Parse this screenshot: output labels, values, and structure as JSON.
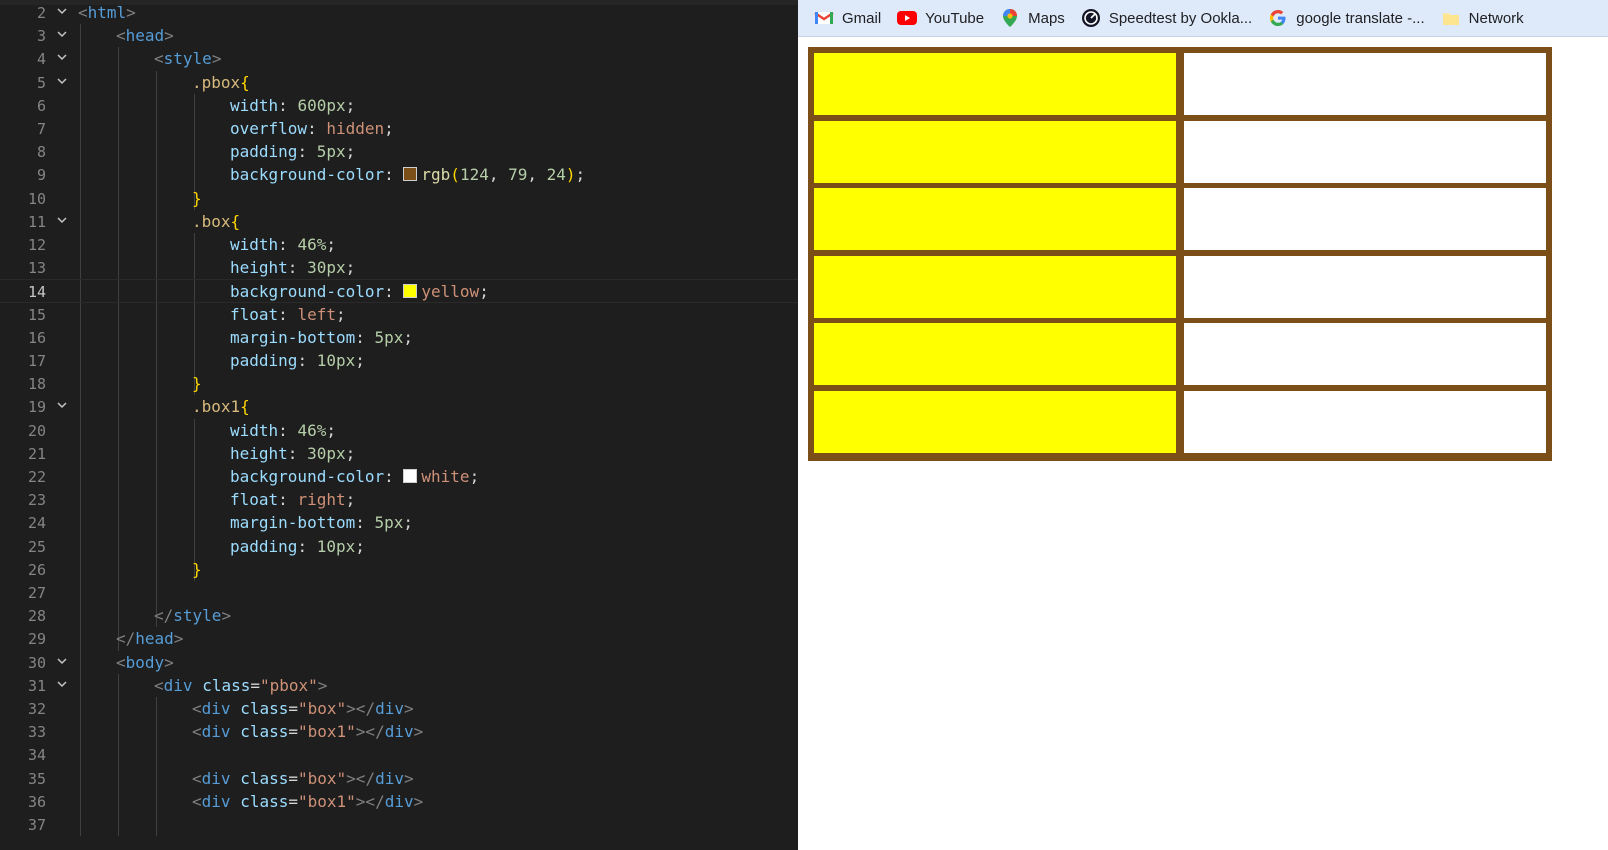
{
  "editor": {
    "lines": [
      {
        "n": "2",
        "fold": true,
        "tokens": [
          [
            "<",
            "t-punc"
          ],
          [
            "html",
            "t-tag"
          ],
          [
            ">",
            "t-punc"
          ]
        ]
      },
      {
        "n": "3",
        "fold": true,
        "tokens": [
          [
            "<",
            "t-punc"
          ],
          [
            "head",
            "t-tag"
          ],
          [
            ">",
            "t-punc"
          ]
        ]
      },
      {
        "n": "4",
        "fold": true,
        "tokens": [
          [
            "<",
            "t-punc"
          ],
          [
            "style",
            "t-tag"
          ],
          [
            ">",
            "t-punc"
          ]
        ]
      },
      {
        "n": "5",
        "fold": true,
        "tokens": [
          [
            ".pbox",
            "t-sel"
          ],
          [
            "{",
            "t-brace"
          ]
        ]
      },
      {
        "n": "6",
        "fold": false,
        "tokens": [
          [
            "width",
            "t-prop"
          ],
          [
            ": ",
            "t-txt"
          ],
          [
            "600px",
            "t-num"
          ],
          [
            ";",
            "t-txt"
          ]
        ]
      },
      {
        "n": "7",
        "fold": false,
        "tokens": [
          [
            "overflow",
            "t-prop"
          ],
          [
            ": ",
            "t-txt"
          ],
          [
            "hidden",
            "t-kw"
          ],
          [
            ";",
            "t-txt"
          ]
        ]
      },
      {
        "n": "8",
        "fold": false,
        "tokens": [
          [
            "padding",
            "t-prop"
          ],
          [
            ": ",
            "t-txt"
          ],
          [
            "5px",
            "t-num"
          ],
          [
            ";",
            "t-txt"
          ]
        ]
      },
      {
        "n": "9",
        "fold": false,
        "tokens": [
          [
            "background-color",
            "t-prop"
          ],
          [
            ": ",
            "t-txt"
          ],
          [
            "@swatch:#7c4f18",
            ""
          ],
          [
            "rgb",
            "t-fn"
          ],
          [
            "(",
            "t-brace"
          ],
          [
            "124",
            "t-num"
          ],
          [
            ", ",
            "t-txt"
          ],
          [
            "79",
            "t-num"
          ],
          [
            ", ",
            "t-txt"
          ],
          [
            "24",
            "t-num"
          ],
          [
            ")",
            "t-brace"
          ],
          [
            ";",
            "t-txt"
          ]
        ]
      },
      {
        "n": "10",
        "fold": false,
        "tokens": [
          [
            "}",
            "t-brace"
          ]
        ]
      },
      {
        "n": "11",
        "fold": true,
        "tokens": [
          [
            ".box",
            "t-sel"
          ],
          [
            "{",
            "t-brace"
          ]
        ]
      },
      {
        "n": "12",
        "fold": false,
        "tokens": [
          [
            "width",
            "t-prop"
          ],
          [
            ": ",
            "t-txt"
          ],
          [
            "46%",
            "t-num"
          ],
          [
            ";",
            "t-txt"
          ]
        ]
      },
      {
        "n": "13",
        "fold": false,
        "tokens": [
          [
            "height",
            "t-prop"
          ],
          [
            ": ",
            "t-txt"
          ],
          [
            "30px",
            "t-num"
          ],
          [
            ";",
            "t-txt"
          ]
        ]
      },
      {
        "n": "14",
        "fold": false,
        "active": true,
        "tokens": [
          [
            "background-color",
            "t-prop"
          ],
          [
            ": ",
            "t-txt"
          ],
          [
            "@swatch:#ffff00",
            ""
          ],
          [
            "yellow",
            "t-kw"
          ],
          [
            ";",
            "t-txt"
          ]
        ]
      },
      {
        "n": "15",
        "fold": false,
        "tokens": [
          [
            "float",
            "t-prop"
          ],
          [
            ": ",
            "t-txt"
          ],
          [
            "left",
            "t-kw"
          ],
          [
            ";",
            "t-txt"
          ]
        ]
      },
      {
        "n": "16",
        "fold": false,
        "tokens": [
          [
            "margin-bottom",
            "t-prop"
          ],
          [
            ": ",
            "t-txt"
          ],
          [
            "5px",
            "t-num"
          ],
          [
            ";",
            "t-txt"
          ]
        ]
      },
      {
        "n": "17",
        "fold": false,
        "tokens": [
          [
            "padding",
            "t-prop"
          ],
          [
            ": ",
            "t-txt"
          ],
          [
            "10px",
            "t-num"
          ],
          [
            ";",
            "t-txt"
          ]
        ]
      },
      {
        "n": "18",
        "fold": false,
        "tokens": [
          [
            "}",
            "t-brace"
          ]
        ]
      },
      {
        "n": "19",
        "fold": true,
        "tokens": [
          [
            ".box1",
            "t-sel"
          ],
          [
            "{",
            "t-brace"
          ]
        ]
      },
      {
        "n": "20",
        "fold": false,
        "tokens": [
          [
            "width",
            "t-prop"
          ],
          [
            ": ",
            "t-txt"
          ],
          [
            "46%",
            "t-num"
          ],
          [
            ";",
            "t-txt"
          ]
        ]
      },
      {
        "n": "21",
        "fold": false,
        "tokens": [
          [
            "height",
            "t-prop"
          ],
          [
            ": ",
            "t-txt"
          ],
          [
            "30px",
            "t-num"
          ],
          [
            ";",
            "t-txt"
          ]
        ]
      },
      {
        "n": "22",
        "fold": false,
        "tokens": [
          [
            "background-color",
            "t-prop"
          ],
          [
            ": ",
            "t-txt"
          ],
          [
            "@swatch:#ffffff",
            ""
          ],
          [
            "white",
            "t-kw"
          ],
          [
            ";",
            "t-txt"
          ]
        ]
      },
      {
        "n": "23",
        "fold": false,
        "tokens": [
          [
            "float",
            "t-prop"
          ],
          [
            ": ",
            "t-txt"
          ],
          [
            "right",
            "t-kw"
          ],
          [
            ";",
            "t-txt"
          ]
        ]
      },
      {
        "n": "24",
        "fold": false,
        "tokens": [
          [
            "margin-bottom",
            "t-prop"
          ],
          [
            ": ",
            "t-txt"
          ],
          [
            "5px",
            "t-num"
          ],
          [
            ";",
            "t-txt"
          ]
        ]
      },
      {
        "n": "25",
        "fold": false,
        "tokens": [
          [
            "padding",
            "t-prop"
          ],
          [
            ": ",
            "t-txt"
          ],
          [
            "10px",
            "t-num"
          ],
          [
            ";",
            "t-txt"
          ]
        ]
      },
      {
        "n": "26",
        "fold": false,
        "tokens": [
          [
            "}",
            "t-brace"
          ]
        ]
      },
      {
        "n": "27",
        "fold": false,
        "tokens": []
      },
      {
        "n": "28",
        "fold": false,
        "tokens": [
          [
            "</",
            "t-punc"
          ],
          [
            "style",
            "t-tag"
          ],
          [
            ">",
            "t-punc"
          ]
        ]
      },
      {
        "n": "29",
        "fold": false,
        "tokens": [
          [
            "</",
            "t-punc"
          ],
          [
            "head",
            "t-tag"
          ],
          [
            ">",
            "t-punc"
          ]
        ]
      },
      {
        "n": "30",
        "fold": true,
        "tokens": [
          [
            "<",
            "t-punc"
          ],
          [
            "body",
            "t-tag"
          ],
          [
            ">",
            "t-punc"
          ]
        ]
      },
      {
        "n": "31",
        "fold": true,
        "tokens": [
          [
            "<",
            "t-punc"
          ],
          [
            "div",
            "t-tag"
          ],
          [
            " ",
            "t-txt"
          ],
          [
            "class",
            "t-attr"
          ],
          [
            "=",
            "t-txt"
          ],
          [
            "\"pbox\"",
            "t-str"
          ],
          [
            ">",
            "t-punc"
          ]
        ]
      },
      {
        "n": "32",
        "fold": false,
        "tokens": [
          [
            "<",
            "t-punc"
          ],
          [
            "div",
            "t-tag"
          ],
          [
            " ",
            "t-txt"
          ],
          [
            "class",
            "t-attr"
          ],
          [
            "=",
            "t-txt"
          ],
          [
            "\"box\"",
            "t-str"
          ],
          [
            "></",
            "t-punc"
          ],
          [
            "div",
            "t-tag"
          ],
          [
            ">",
            "t-punc"
          ]
        ]
      },
      {
        "n": "33",
        "fold": false,
        "tokens": [
          [
            "<",
            "t-punc"
          ],
          [
            "div",
            "t-tag"
          ],
          [
            " ",
            "t-txt"
          ],
          [
            "class",
            "t-attr"
          ],
          [
            "=",
            "t-txt"
          ],
          [
            "\"box1\"",
            "t-str"
          ],
          [
            "></",
            "t-punc"
          ],
          [
            "div",
            "t-tag"
          ],
          [
            ">",
            "t-punc"
          ]
        ]
      },
      {
        "n": "34",
        "fold": false,
        "tokens": []
      },
      {
        "n": "35",
        "fold": false,
        "tokens": [
          [
            "<",
            "t-punc"
          ],
          [
            "div",
            "t-tag"
          ],
          [
            " ",
            "t-txt"
          ],
          [
            "class",
            "t-attr"
          ],
          [
            "=",
            "t-txt"
          ],
          [
            "\"box\"",
            "t-str"
          ],
          [
            "></",
            "t-punc"
          ],
          [
            "div",
            "t-tag"
          ],
          [
            ">",
            "t-punc"
          ]
        ]
      },
      {
        "n": "36",
        "fold": false,
        "tokens": [
          [
            "<",
            "t-punc"
          ],
          [
            "div",
            "t-tag"
          ],
          [
            " ",
            "t-txt"
          ],
          [
            "class",
            "t-attr"
          ],
          [
            "=",
            "t-txt"
          ],
          [
            "\"box1\"",
            "t-str"
          ],
          [
            "></",
            "t-punc"
          ],
          [
            "div",
            "t-tag"
          ],
          [
            ">",
            "t-punc"
          ]
        ]
      },
      {
        "n": "37",
        "fold": false,
        "tokens": []
      }
    ]
  },
  "bookmarks": [
    {
      "label": "Gmail",
      "icon": "gmail-icon"
    },
    {
      "label": "YouTube",
      "icon": "youtube-icon"
    },
    {
      "label": "Maps",
      "icon": "maps-icon"
    },
    {
      "label": "Speedtest by Ookla...",
      "icon": "speedtest-icon"
    },
    {
      "label": "google translate -...",
      "icon": "google-icon"
    },
    {
      "label": "Network",
      "icon": "folder-icon"
    }
  ],
  "preview": {
    "rows": 6,
    "colors": {
      "container": "#7c4f18",
      "left": "#ffff00",
      "right": "#ffffff"
    }
  }
}
